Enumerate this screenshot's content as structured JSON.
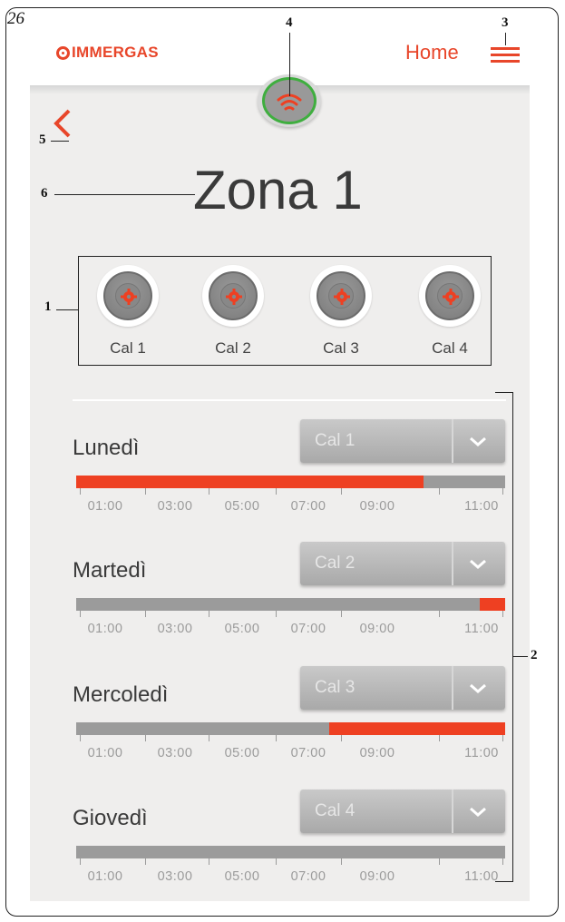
{
  "page_number": "26",
  "callouts": {
    "c1": "1",
    "c2": "2",
    "c3": "3",
    "c4": "4",
    "c5": "5",
    "c6": "6"
  },
  "header": {
    "brand": "IMMERGAS",
    "home_label": "Home"
  },
  "zone": {
    "title": "Zona 1"
  },
  "calendars": [
    {
      "label": "Cal 1"
    },
    {
      "label": "Cal 2"
    },
    {
      "label": "Cal 3"
    },
    {
      "label": "Cal 4"
    }
  ],
  "days": [
    {
      "name": "Lunedì",
      "selected": "Cal 1",
      "active_fraction": [
        0.0,
        0.81
      ]
    },
    {
      "name": "Martedì",
      "selected": "Cal 2",
      "active_fraction": [
        0.94,
        1.0
      ]
    },
    {
      "name": "Mercoledì",
      "selected": "Cal 3",
      "active_fraction": [
        0.59,
        1.0
      ]
    },
    {
      "name": "Giovedì",
      "selected": "Cal 4",
      "active_fraction": [
        0,
        0
      ]
    }
  ],
  "hours": [
    "01:00",
    "03:00",
    "05:00",
    "07:00",
    "09:00",
    "11:00"
  ],
  "colors": {
    "accent": "#e8462a",
    "bar_active": "#ee4022",
    "bar_inactive": "#9b9b9b",
    "wifi_ring": "#3fae3f"
  },
  "icons": [
    "immergas-logo-icon",
    "menu-icon",
    "wifi-icon",
    "back-chevron-icon",
    "gear-icon",
    "chevron-down-icon"
  ]
}
